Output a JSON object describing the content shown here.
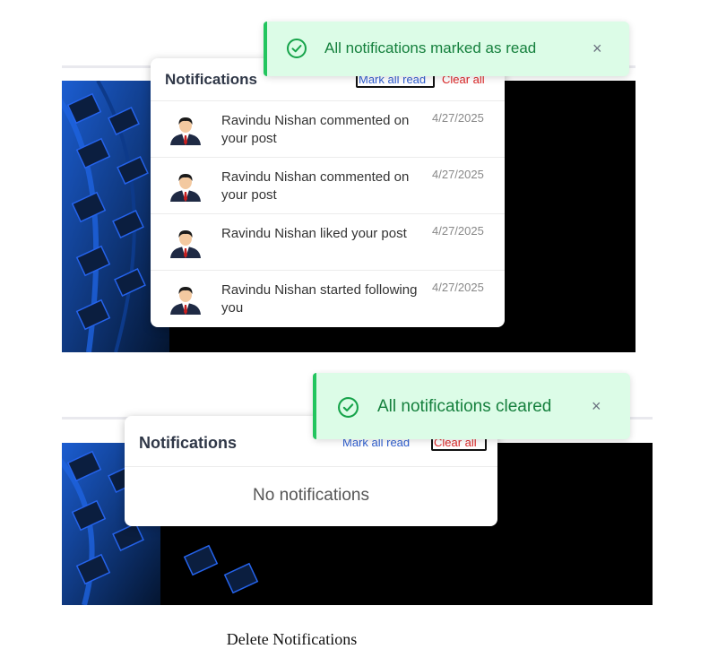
{
  "screenshot_top": {
    "toast": {
      "icon": "check-circle-icon",
      "message": "All notifications marked as read",
      "close_icon": "×"
    },
    "panel": {
      "title": "Notifications",
      "mark_all_read": "Mark all read",
      "clear_all": "Clear all",
      "items": [
        {
          "avatar": "user-avatar-icon",
          "text": "Ravindu Nishan commented on your post",
          "date": "4/27/2025"
        },
        {
          "avatar": "user-avatar-icon",
          "text": "Ravindu Nishan commented on your post",
          "date": "4/27/2025"
        },
        {
          "avatar": "user-avatar-icon",
          "text": "Ravindu Nishan liked your post",
          "date": "4/27/2025"
        },
        {
          "avatar": "user-avatar-icon",
          "text": "Ravindu Nishan started following you",
          "date": "4/27/2025"
        }
      ]
    }
  },
  "screenshot_bottom": {
    "toast": {
      "icon": "check-circle-icon",
      "message": "All notifications cleared",
      "close_icon": "×"
    },
    "panel": {
      "title": "Notifications",
      "mark_all_read": "Mark all read",
      "clear_all": "Clear all",
      "empty_message": "No notifications"
    }
  },
  "caption": "Delete Notifications",
  "colors": {
    "toast_bg": "#dcfce7",
    "toast_accent": "#22c55e",
    "toast_text": "#15803d",
    "mark_link": "#2f5fd0",
    "clear_link": "#dc2626",
    "background_photo": "#000000"
  }
}
